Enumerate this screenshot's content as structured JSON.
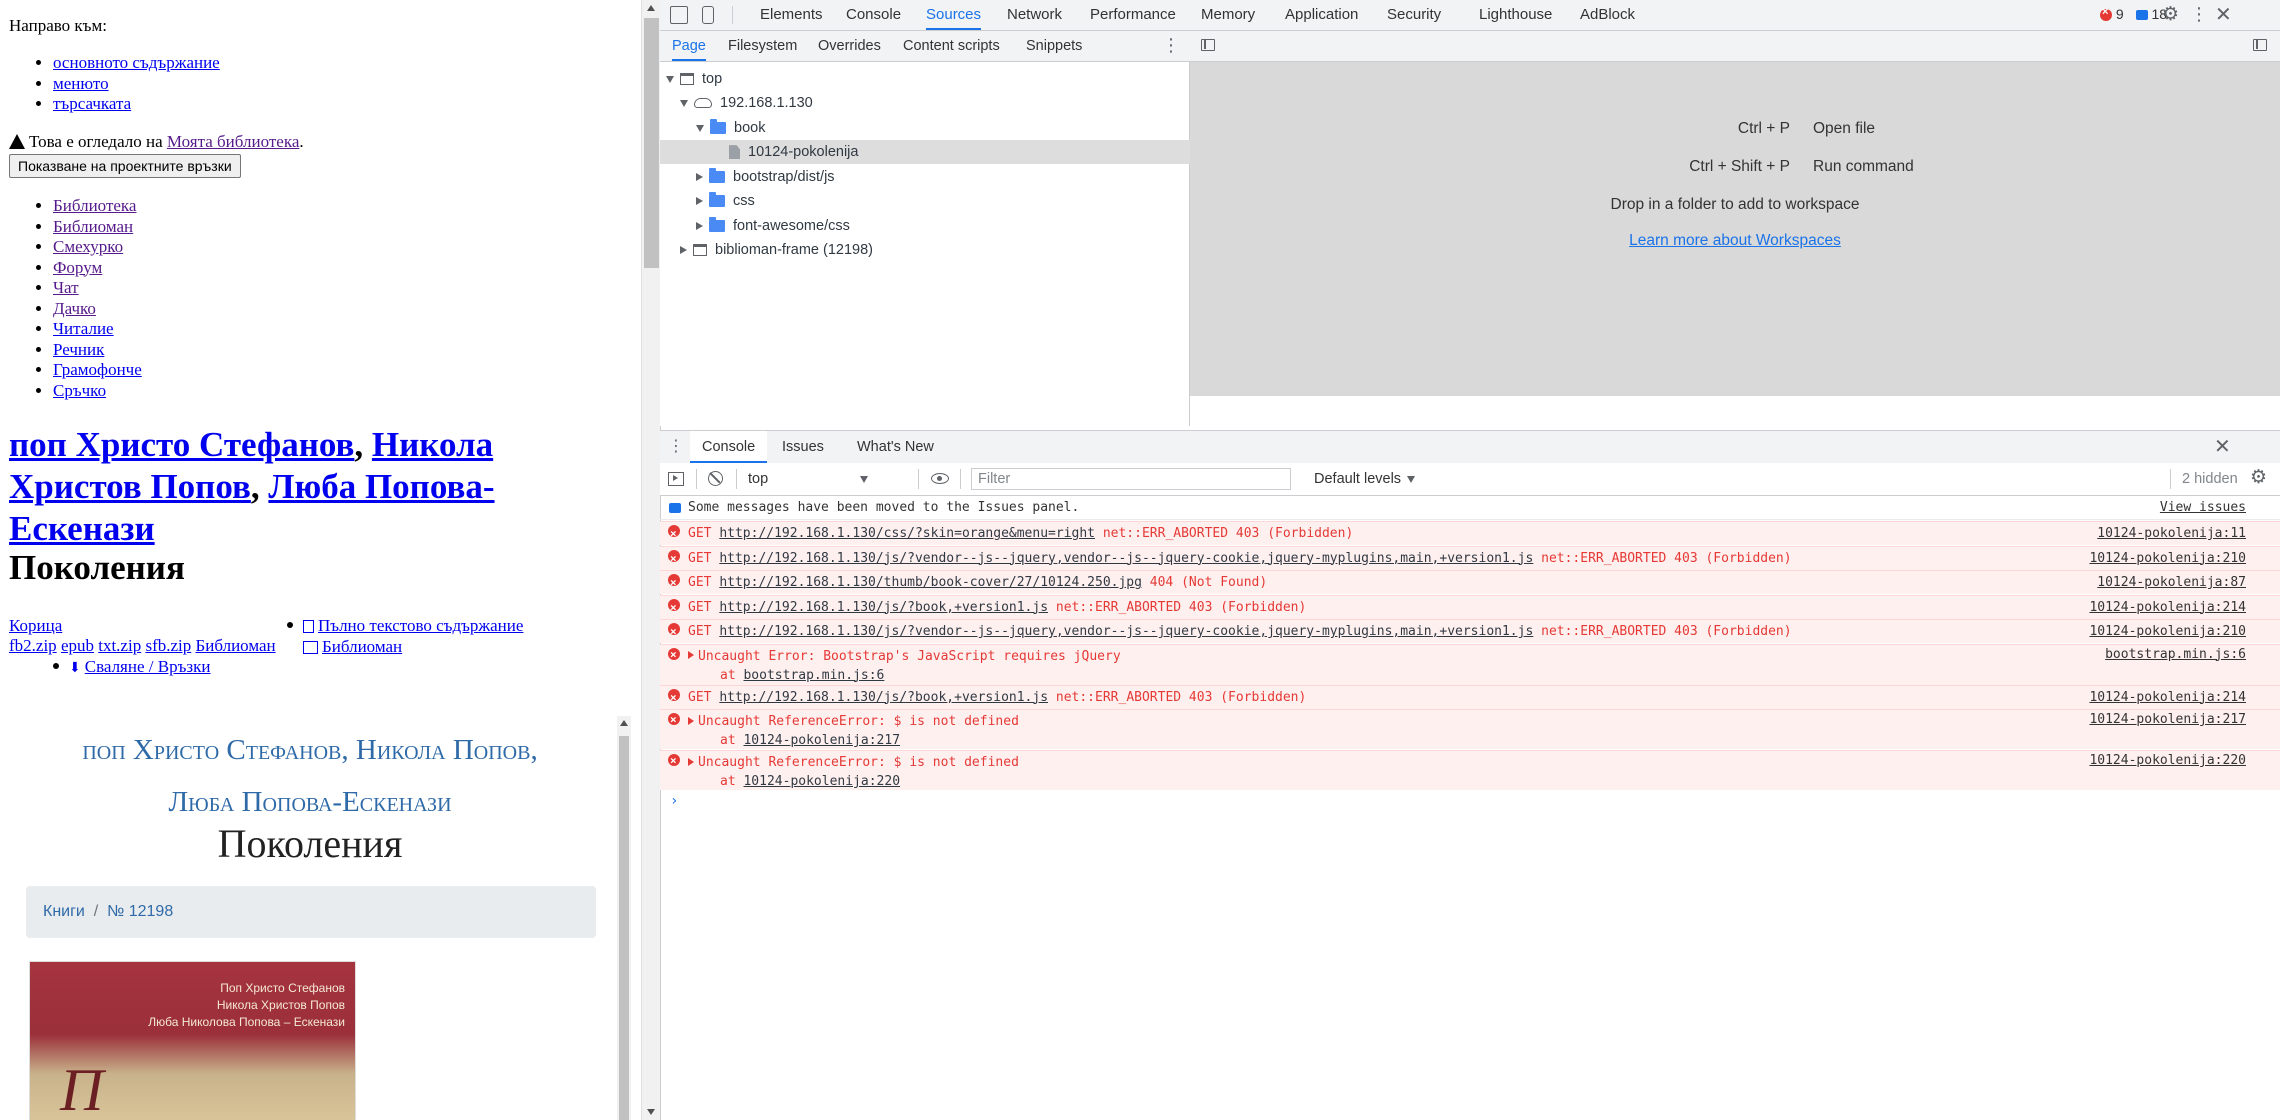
{
  "page": {
    "skip_title": "Направо към:",
    "skip_links": [
      "основното съдържание",
      "менюто",
      "търсачката"
    ],
    "mirror_text": "Това е огледало на",
    "mirror_link": "Моята библиотека",
    "mirror_dot": ".",
    "project_button": "Показване на проектните връзки",
    "nav": [
      "Библиотека",
      "Библиоман",
      "Смехурко",
      "Форум",
      "Чат",
      "Дачко",
      "Читалие",
      "Речник",
      "Грамофонче",
      "Сръчко"
    ],
    "authors": [
      "поп Христо Стефанов",
      "Никола Христов Попов",
      "Люба Попова-Ескенази"
    ],
    "sep": ",",
    "book_title": "Поколения",
    "cover_alt": "Корица",
    "formats": [
      "fb2.zip",
      "epub",
      "txt.zip",
      "sfb.zip",
      "Библиоман"
    ],
    "toc_link": "Пълно текстово съдържание",
    "biblioman_link": "Библиоман",
    "download_link": "Сваляне / Връзки",
    "styled_authors_line1": [
      "поп Христо Стефанов",
      "Никола Попов"
    ],
    "styled_authors_line2": "Люба Попова-Ескенази",
    "styled_title": "Поколения",
    "breadcrumb": {
      "first": "Книги",
      "slash": "/",
      "second": "№ 12198"
    },
    "cover_lines": [
      "Поп Христо Стефанов",
      "Никола Христов Попов",
      "Люба Николова Попова – Ескенази"
    ],
    "cover_letter": "П"
  },
  "devtools": {
    "main_tabs": [
      "Elements",
      "Console",
      "Sources",
      "Network",
      "Performance",
      "Memory",
      "Application",
      "Security",
      "Lighthouse",
      "AdBlock"
    ],
    "active_tab": "Sources",
    "error_count": "9",
    "message_count": "18",
    "source_tabs": [
      "Page",
      "Filesystem",
      "Overrides",
      "Content scripts",
      "Snippets"
    ],
    "tree": {
      "top": "top",
      "host": "192.168.1.130",
      "book": "book",
      "file": "10124-pokolenija",
      "folders": [
        "bootstrap/dist/js",
        "css",
        "font-awesome/css"
      ],
      "frame": "biblioman-frame (12198)"
    },
    "workspace": {
      "shortcut1_key": "Ctrl + P",
      "shortcut1_action": "Open file",
      "shortcut2_key": "Ctrl + Shift + P",
      "shortcut2_action": "Run command",
      "drop": "Drop in a folder to add to workspace",
      "learn": "Learn more about Workspaces"
    },
    "drawer_tabs": [
      "Console",
      "Issues",
      "What's New"
    ],
    "console": {
      "context": "top",
      "filter_placeholder": "Filter",
      "levels": "Default levels",
      "hidden": "2 hidden",
      "info": "Some messages have been moved to the Issues panel.",
      "view_issues": "View issues",
      "messages": [
        {
          "kind": "get",
          "method": "GET",
          "url": "http://192.168.1.130/css/?skin=orange&menu=right",
          "status": "net::ERR_ABORTED 403 (Forbidden)",
          "source": "10124-pokolenija:11"
        },
        {
          "kind": "get",
          "method": "GET",
          "url": "http://192.168.1.130/js/?vendor--js--jquery,vendor--js--jquery-cookie,jquery-myplugins,main,+version1.js",
          "status": "net::ERR_ABORTED 403 (Forbidden)",
          "source": "10124-pokolenija:210"
        },
        {
          "kind": "get",
          "method": "GET",
          "url": "http://192.168.1.130/thumb/book-cover/27/10124.250.jpg",
          "status": "404 (Not Found)",
          "source": "10124-pokolenija:87"
        },
        {
          "kind": "get",
          "method": "GET",
          "url": "http://192.168.1.130/js/?book,+version1.js",
          "status": "net::ERR_ABORTED 403 (Forbidden)",
          "source": "10124-pokolenija:214"
        },
        {
          "kind": "get",
          "method": "GET",
          "url": "http://192.168.1.130/js/?vendor--js--jquery,vendor--js--jquery-cookie,jquery-myplugins,main,+version1.js",
          "status": "net::ERR_ABORTED 403 (Forbidden)",
          "source": "10124-pokolenija:210"
        },
        {
          "kind": "exc",
          "text": "Uncaught Error: Bootstrap's JavaScript requires jQuery",
          "at": "at",
          "at_link": "bootstrap.min.js:6",
          "source": "bootstrap.min.js:6"
        },
        {
          "kind": "get",
          "method": "GET",
          "url": "http://192.168.1.130/js/?book,+version1.js",
          "status": "net::ERR_ABORTED 403 (Forbidden)",
          "source": "10124-pokolenija:214"
        },
        {
          "kind": "exc",
          "text": "Uncaught ReferenceError: $ is not defined",
          "at": "at",
          "at_link": "10124-pokolenija:217",
          "source": "10124-pokolenija:217"
        },
        {
          "kind": "exc",
          "text": "Uncaught ReferenceError: $ is not defined",
          "at": "at",
          "at_link": "10124-pokolenija:220",
          "source": "10124-pokolenija:220"
        }
      ]
    },
    "colors": {
      "accent": "#1a73e8",
      "error": "#e53935",
      "error_bg": "#fff0f0"
    }
  }
}
